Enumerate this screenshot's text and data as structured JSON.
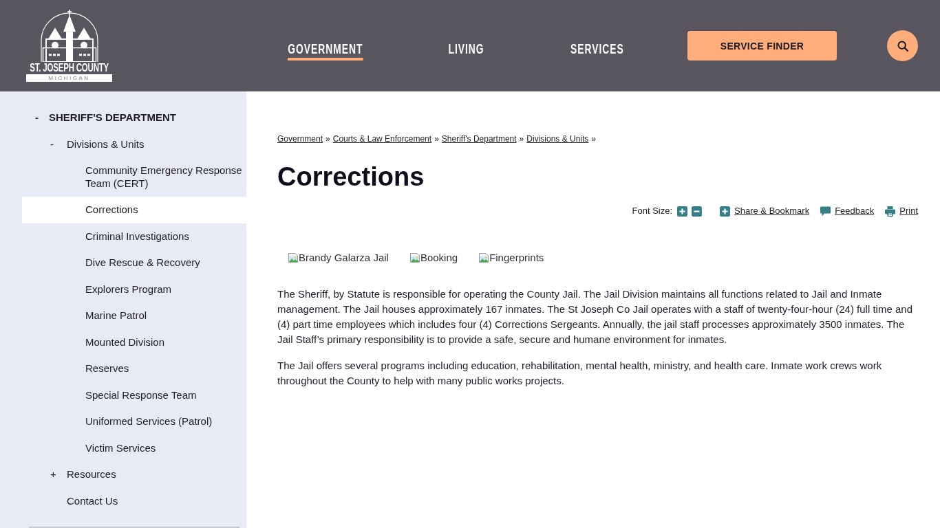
{
  "header": {
    "logo": {
      "title": "ST. JOSEPH COUNTY",
      "subtitle": "MICHIGAN"
    },
    "nav": [
      {
        "label": "GOVERNMENT",
        "selected": true
      },
      {
        "label": "LIVING",
        "selected": false
      },
      {
        "label": "SERVICES",
        "selected": false
      }
    ],
    "service_finder": "SERVICE FINDER"
  },
  "sidebar": {
    "items": [
      {
        "label": "SHERIFF'S DEPARTMENT",
        "toggle": "-",
        "selected": false,
        "children": [
          {
            "label": "Divisions & Units",
            "toggle": "-",
            "selected": false,
            "children": [
              {
                "label": "Community Emergency Response Team (CERT)",
                "selected": false
              },
              {
                "label": "Corrections",
                "selected": true
              },
              {
                "label": "Criminal Investigations",
                "selected": false
              },
              {
                "label": "Dive Rescue & Recovery",
                "selected": false
              },
              {
                "label": "Explorers Program",
                "selected": false
              },
              {
                "label": "Marine Patrol",
                "selected": false
              },
              {
                "label": "Mounted Division",
                "selected": false
              },
              {
                "label": "Reserves",
                "selected": false
              },
              {
                "label": "Special Response Team",
                "selected": false
              },
              {
                "label": "Uniformed Services (Patrol)",
                "selected": false
              },
              {
                "label": "Victim Services",
                "selected": false
              }
            ]
          },
          {
            "label": "Resources",
            "toggle": "+",
            "selected": false
          },
          {
            "label": "Contact Us",
            "selected": false
          }
        ]
      }
    ]
  },
  "breadcrumb": [
    {
      "label": "Government",
      "separator": "»"
    },
    {
      "label": "Courts & Law Enforcement",
      "separator": "»"
    },
    {
      "label": "Sheriff's Department",
      "separator": "»"
    },
    {
      "label": "Divisions & Units",
      "separator": "»"
    }
  ],
  "title": "Corrections",
  "tools": {
    "font_size_label": "Font Size:",
    "actions": [
      {
        "kind": "share",
        "label": "Share & Bookmark"
      },
      {
        "kind": "feedback",
        "label": "Feedback"
      },
      {
        "kind": "print",
        "label": "Print"
      }
    ]
  },
  "images": [
    {
      "alt": "Brandy Galarza Jail"
    },
    {
      "alt": "Booking"
    },
    {
      "alt": "Fingerprints"
    }
  ],
  "paragraphs": [
    "The Sheriff, by Statute is responsible for operating the County Jail. The Jail Division maintains all functions related to Jail and Inmate management. The Jail houses approximately 167 inmates. The St Joseph Co Jail operates with a staff of twenty-four-hour (24) full time and (4) part time employees which includes four (4) Corrections Sergeants. Annually, the jail staff processes approximately 3500 inmates. The Jail Staff’s primary responsibility is to provide a safe, secure and humane environment for inmates.",
    "The Jail offers several programs including education, rehabilitation, mental health, ministry, and health care. Inmate work crews work throughout the County to help with many public works projects."
  ]
}
